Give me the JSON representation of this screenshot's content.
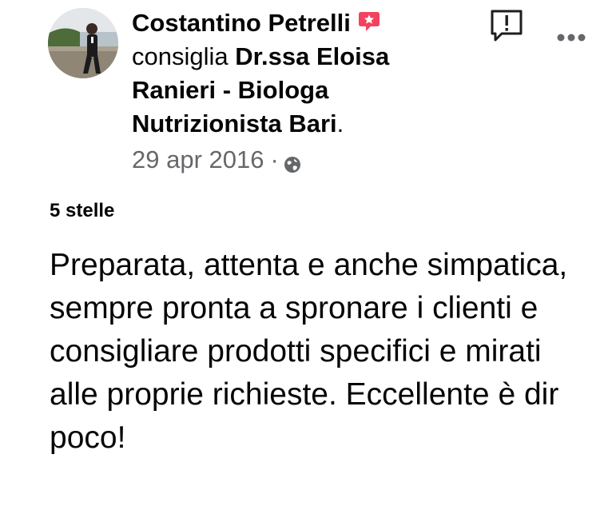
{
  "post": {
    "author": "Costantino Petrelli",
    "action": "consiglia",
    "page_name": "Dr.ssa Eloisa Ranieri - Biologa Nutrizionista Bari",
    "punct": ".",
    "date": "29 apr 2016",
    "separator": "·",
    "privacy_icon": "globe-icon",
    "recommend_icon": "recommend-icon",
    "rating_label": "5 stelle",
    "review_text": "Preparata, attenta e anche simpatica, sempre pronta a spronare i clienti e consigliare prodotti specifici e mirati alle proprie richieste. Eccellente è dir poco!"
  },
  "icons": {
    "report": "report-icon",
    "more": "more-options-icon"
  },
  "colors": {
    "recommend_red": "#f3425f",
    "meta_gray": "#65676b",
    "text": "#050505"
  }
}
